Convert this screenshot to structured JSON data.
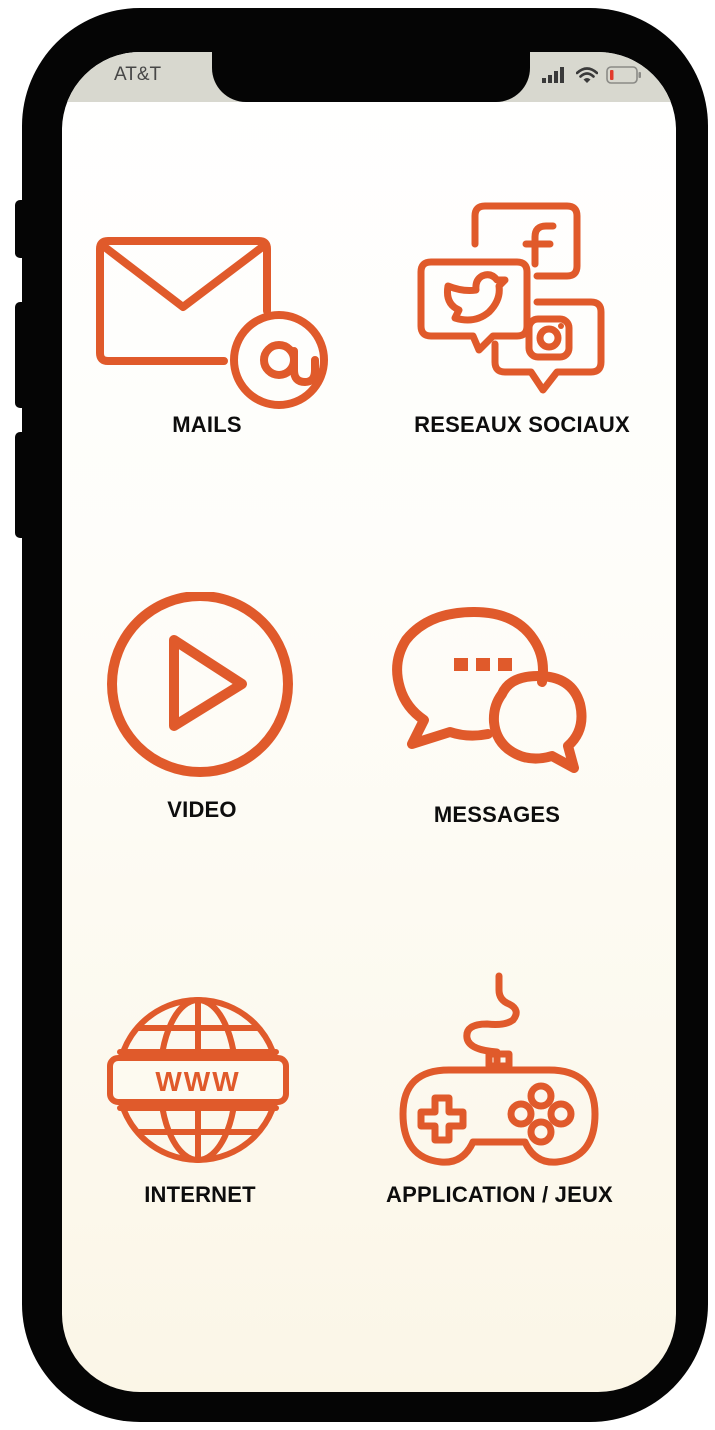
{
  "status_bar": {
    "carrier": "AT&T",
    "signal_icon": "cellular-signal-icon",
    "wifi_icon": "wifi-icon",
    "battery_icon": "battery-low-icon"
  },
  "accent_color": "#e05a2b",
  "tiles": [
    {
      "label": "MAILS",
      "icon": "mail-at-icon"
    },
    {
      "label": "RESEAUX SOCIAUX",
      "icon": "social-networks-icon"
    },
    {
      "label": "VIDEO",
      "icon": "play-circle-icon"
    },
    {
      "label": "MESSAGES",
      "icon": "chat-bubbles-icon"
    },
    {
      "label": "INTERNET",
      "icon": "globe-www-icon"
    },
    {
      "label": "APPLICATION / JEUX",
      "icon": "gamepad-icon"
    }
  ]
}
